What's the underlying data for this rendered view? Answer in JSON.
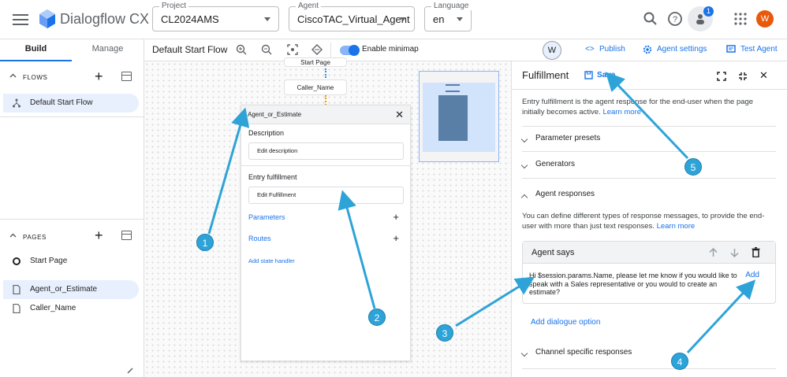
{
  "app": {
    "title": "Dialogflow CX"
  },
  "selectors": {
    "project": {
      "label": "Project",
      "value": "CL2024AMS"
    },
    "agent": {
      "label": "Agent",
      "value": "CiscoTAC_Virtual_Agent"
    },
    "language": {
      "label": "Language",
      "value": "en"
    }
  },
  "topbar": {
    "notification_count": "1",
    "avatar_initial": "W"
  },
  "left": {
    "tabs": [
      "Build",
      "Manage"
    ],
    "flows_header": "FLOWS",
    "flows": [
      "Default Start Flow"
    ],
    "pages_header": "PAGES",
    "pages": [
      "Start Page",
      "Agent_or_Estimate",
      "Caller_Name"
    ]
  },
  "canvas_bar": {
    "flow_title": "Default Start Flow",
    "minimap_label": "Enable minimap"
  },
  "right_bar": {
    "user_initial": "W",
    "publish": "Publish",
    "agent_settings": "Agent settings",
    "test_agent": "Test Agent"
  },
  "canvas": {
    "nodes": [
      "Start Page",
      "Caller_Name"
    ]
  },
  "page_panel": {
    "title": "Agent_or_Estimate",
    "description_label": "Description",
    "description_placeholder": "Edit description",
    "entry_label": "Entry fulfillment",
    "entry_value": "Edit Fulfillment",
    "parameters": "Parameters",
    "routes": "Routes",
    "state_handler": "Add state handler"
  },
  "fulfillment": {
    "title": "Fulfillment",
    "save": "Save",
    "intro": "Entry fulfillment is the agent response for the end-user when the page initially becomes active.",
    "intro_link": "Learn more",
    "sections": [
      "Parameter presets",
      "Generators",
      "Agent responses"
    ],
    "responses_text": "You can define different types of response messages, to provide the end-user with more than just text responses.",
    "responses_link": "Learn more",
    "agent_says_label": "Agent says",
    "agent_says_text": "Hi $session.params.Name, please let me know if you would like to speak with a Sales representative or you would to create an estimate?",
    "add": "Add",
    "add_dialogue": "Add dialogue option",
    "channel_section": "Channel specific responses"
  },
  "callouts": [
    "1",
    "2",
    "3",
    "4",
    "5"
  ]
}
